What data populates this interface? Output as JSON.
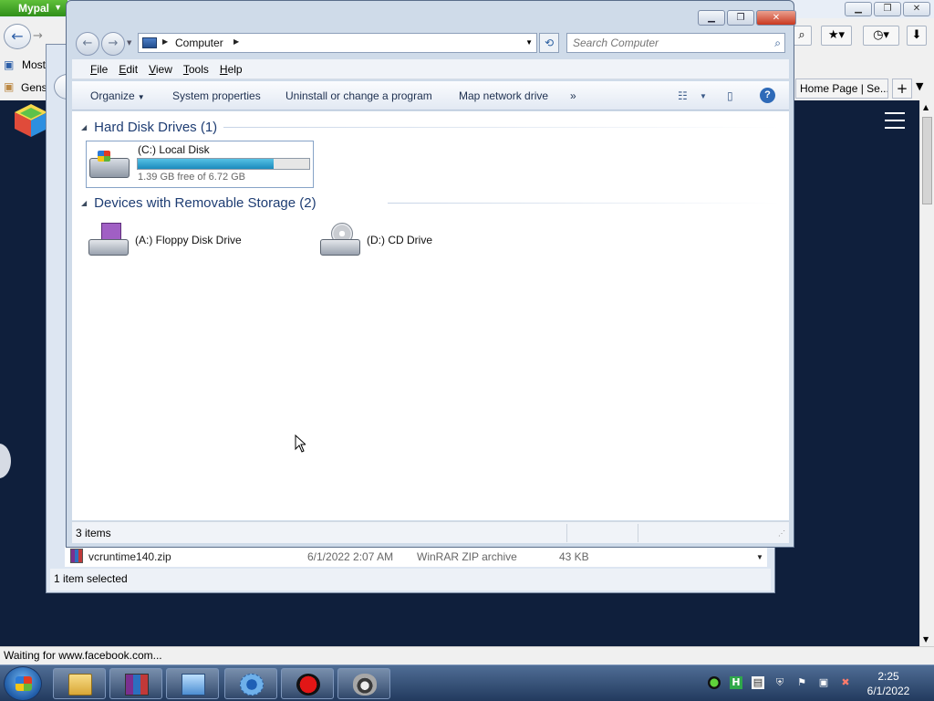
{
  "browser": {
    "app_menu": "Mypal",
    "bookmarks": [
      "Most",
      "Gens"
    ],
    "right_tab": "Home Page | Se...",
    "status": "Waiting for www.facebook.com..."
  },
  "downloads": {
    "file": {
      "name": "vcruntime140.zip",
      "date": "6/1/2022 2:07 AM",
      "type": "WinRAR ZIP archive",
      "size": "43 KB"
    },
    "status": "1 item selected"
  },
  "computer": {
    "breadcrumb": "Computer",
    "search_placeholder": "Search Computer",
    "menu": [
      "File",
      "Edit",
      "View",
      "Tools",
      "Help"
    ],
    "commands": {
      "organize": "Organize",
      "system_properties": "System properties",
      "uninstall": "Uninstall or change a program",
      "map_drive": "Map network drive",
      "more": "»"
    },
    "groups": {
      "hdd": "Hard Disk Drives (1)",
      "removable": "Devices with Removable Storage (2)"
    },
    "local_disk": {
      "name": "(C:) Local Disk",
      "free": "1.39 GB free of 6.72 GB",
      "used_fraction": 0.79
    },
    "floppy": "(A:) Floppy Disk Drive",
    "cd": "(D:) CD Drive",
    "status_count": "3 items"
  },
  "taskbar": {
    "time": "2:25",
    "date": "6/1/2022"
  },
  "icons": {
    "window_controls": [
      "minimize-icon",
      "maximize-icon",
      "close-icon"
    ],
    "taskbar": [
      "start-orb",
      "explorer-icon",
      "winrar-icon",
      "control-panel-icon",
      "settings-icon",
      "record-icon",
      "raccoon-icon"
    ],
    "tray": [
      "green-circle-icon",
      "h-icon",
      "document-icon",
      "security-shield-icon",
      "flag-icon",
      "network-icon",
      "volume-muted-icon"
    ]
  },
  "colors": {
    "accent": "#1e3d73",
    "progress": "#26a0da",
    "page_background": "#0f1f3c"
  }
}
